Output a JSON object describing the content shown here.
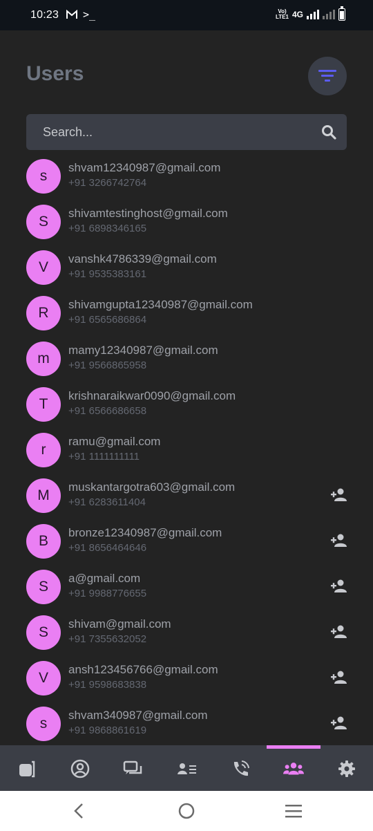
{
  "status_bar": {
    "time": "10:23",
    "terminal_glyph": ">_",
    "network": "4G",
    "volte_line1": "Vo)",
    "volte_line2": "LTE1"
  },
  "header": {
    "title": "Users",
    "filter_icon": "filter-list-icon",
    "accent": "#5b5cf0"
  },
  "search": {
    "placeholder": "Search...",
    "icon": "search-icon"
  },
  "colors": {
    "background": "#232323",
    "avatar": "#ea7ff3",
    "nav_active": "#ea7ff3",
    "nav_inactive": "#c7c9ce"
  },
  "users": [
    {
      "initial": "s",
      "email": "shvam12340987@gmail.com",
      "phone": "+91 3266742764",
      "add_friend": false
    },
    {
      "initial": "S",
      "email": "shivamtestinghost@gmail.com",
      "phone": "+91 6898346165",
      "add_friend": false
    },
    {
      "initial": "V",
      "email": "vanshk4786339@gmail.com",
      "phone": "+91 9535383161",
      "add_friend": false
    },
    {
      "initial": "R",
      "email": "shivamgupta12340987@gmail.com",
      "phone": "+91 6565686864",
      "add_friend": false
    },
    {
      "initial": "m",
      "email": "mamy12340987@gmail.com",
      "phone": "+91 9566865958",
      "add_friend": false
    },
    {
      "initial": "T",
      "email": "krishnaraikwar0090@gmail.com",
      "phone": "+91 6566686658",
      "add_friend": false
    },
    {
      "initial": "r",
      "email": "ramu@gmail.com",
      "phone": "+91 1111111111",
      "add_friend": false
    },
    {
      "initial": "M",
      "email": "muskantargotra603@gmail.com",
      "phone": "+91 6283611404",
      "add_friend": true
    },
    {
      "initial": "B",
      "email": "bronze12340987@gmail.com",
      "phone": "+91 8656464646",
      "add_friend": true
    },
    {
      "initial": "S",
      "email": "a@gmail.com",
      "phone": "+91 9988776655",
      "add_friend": true
    },
    {
      "initial": "S",
      "email": "shivam@gmail.com",
      "phone": "+91 7355632052",
      "add_friend": true
    },
    {
      "initial": "V",
      "email": "ansh123456766@gmail.com",
      "phone": "+91 9598683838",
      "add_friend": true
    },
    {
      "initial": "s",
      "email": "shvam340987@gmail.com",
      "phone": "+91 9868861619",
      "add_friend": true
    }
  ],
  "bottom_nav": {
    "active_index": 5,
    "items": [
      {
        "icon": "stories-icon"
      },
      {
        "icon": "profile-icon"
      },
      {
        "icon": "chats-icon"
      },
      {
        "icon": "contacts-icon"
      },
      {
        "icon": "calls-icon"
      },
      {
        "icon": "users-icon"
      },
      {
        "icon": "settings-icon"
      }
    ]
  },
  "system_nav": {
    "back": "back-icon",
    "home": "home-icon",
    "recents": "recents-icon"
  }
}
